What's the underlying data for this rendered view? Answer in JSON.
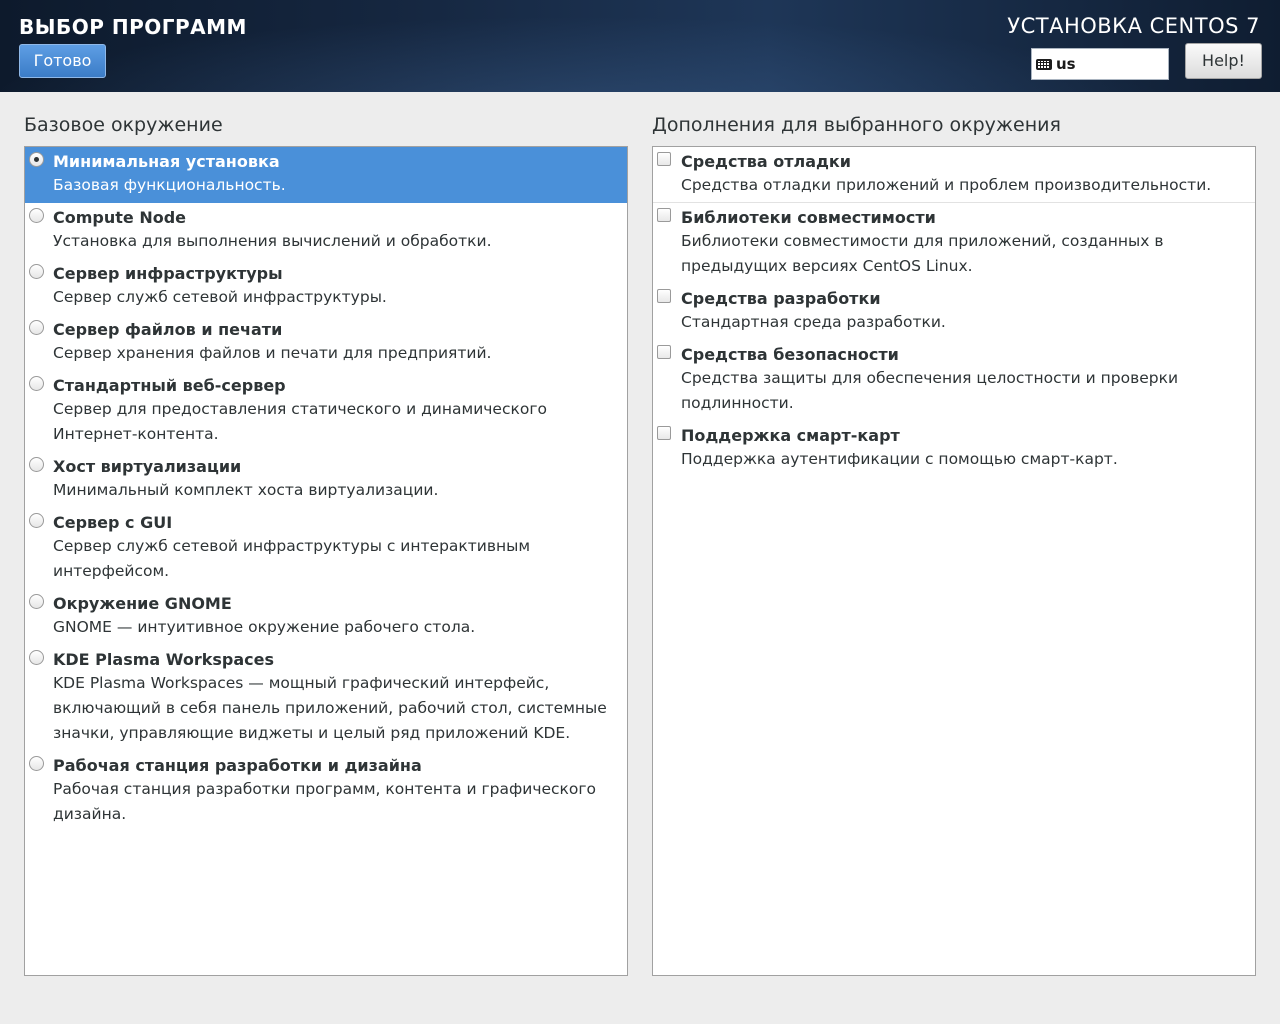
{
  "header": {
    "spoke_title": "ВЫБОР ПРОГРАММ",
    "done_label": "Готово",
    "product_title": "УСТАНОВКА CENTOS 7",
    "keyboard_layout": "us",
    "help_label": "Help!"
  },
  "base": {
    "heading": "Базовое окружение",
    "selected_index": 0,
    "items": [
      {
        "title": "Минимальная установка",
        "desc": "Базовая функциональность."
      },
      {
        "title": "Compute Node",
        "desc": "Установка для выполнения вычислений и обработки."
      },
      {
        "title": "Сервер инфраструктуры",
        "desc": "Сервер служб сетевой инфраструктуры."
      },
      {
        "title": "Сервер файлов и печати",
        "desc": "Сервер хранения файлов и печати для предприятий."
      },
      {
        "title": "Стандартный веб-сервер",
        "desc": "Сервер для предоставления статического и динамического Интернет-контента."
      },
      {
        "title": "Хост виртуализации",
        "desc": "Минимальный комплект хоста виртуализации."
      },
      {
        "title": "Сервер с GUI",
        "desc": "Сервер служб сетевой инфраструктуры с интерактивным интерфейсом."
      },
      {
        "title": "Окружение GNOME",
        "desc": "GNOME — интуитивное окружение рабочего стола."
      },
      {
        "title": "KDE Plasma Workspaces",
        "desc": "KDE Plasma Workspaces — мощный графический интерфейс, включающий в себя панель приложений, рабочий стол, системные значки, управляющие виджеты и целый ряд приложений KDE."
      },
      {
        "title": "Рабочая станция разработки и дизайна",
        "desc": "Рабочая станция разработки программ, контента и графического дизайна."
      }
    ]
  },
  "addons": {
    "heading": "Дополнения для выбранного окружения",
    "items": [
      {
        "title": "Средства отладки",
        "desc": "Средства отладки приложений и проблем производительности.",
        "checked": false
      },
      {
        "title": "Библиотеки совместимости",
        "desc": "Библиотеки совместимости для приложений, созданных в предыдущих версиях CentOS Linux.",
        "checked": false
      },
      {
        "title": "Средства разработки",
        "desc": "Стандартная среда разработки.",
        "checked": false
      },
      {
        "title": "Средства безопасности",
        "desc": "Средства защиты для обеспечения целостности и проверки подлинности.",
        "checked": false
      },
      {
        "title": "Поддержка смарт-карт",
        "desc": "Поддержка аутентификации с помощью смарт-карт.",
        "checked": false
      }
    ]
  },
  "colors": {
    "selection": "#4a90d9",
    "header_bg": "#15263f",
    "accent_button": "#4a8ad6"
  },
  "icons": {
    "keyboard": "keyboard-icon"
  }
}
